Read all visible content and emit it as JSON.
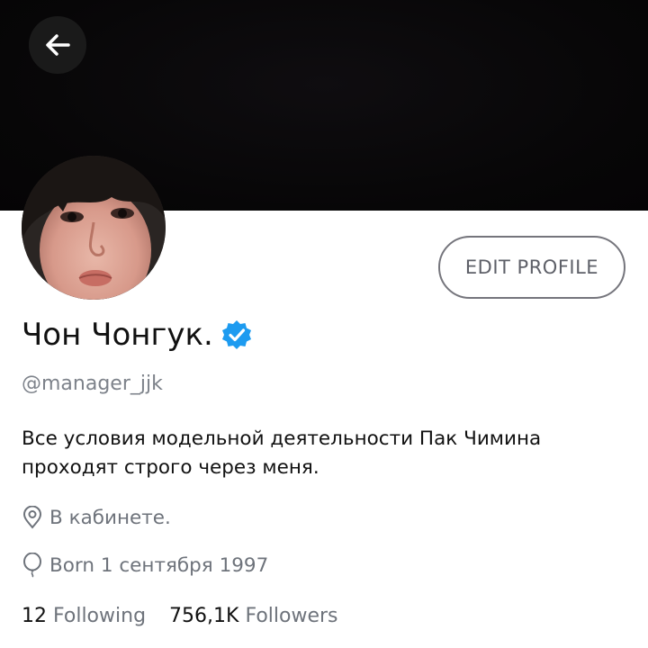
{
  "header": {
    "back_icon": "arrow-left-icon",
    "banner_color": "#070607"
  },
  "profile": {
    "name": "Чон Чонгук.",
    "verified_icon": "verified-badge-icon",
    "verified_color": "#1d9bf0",
    "handle": "@manager_jjk",
    "bio": "Все условия модельной деятельности Пак Чимина проходят строго через меня.",
    "location_icon": "location-pin-icon",
    "location": "В кабинете.",
    "birthday_icon": "balloon-icon",
    "birthday": "Born 1 сентября 1997"
  },
  "actions": {
    "edit_profile_label": "EDIT PROFILE"
  },
  "stats": {
    "following_count": "12",
    "following_label": "Following",
    "followers_count": "756,1K",
    "followers_label": "Followers"
  }
}
